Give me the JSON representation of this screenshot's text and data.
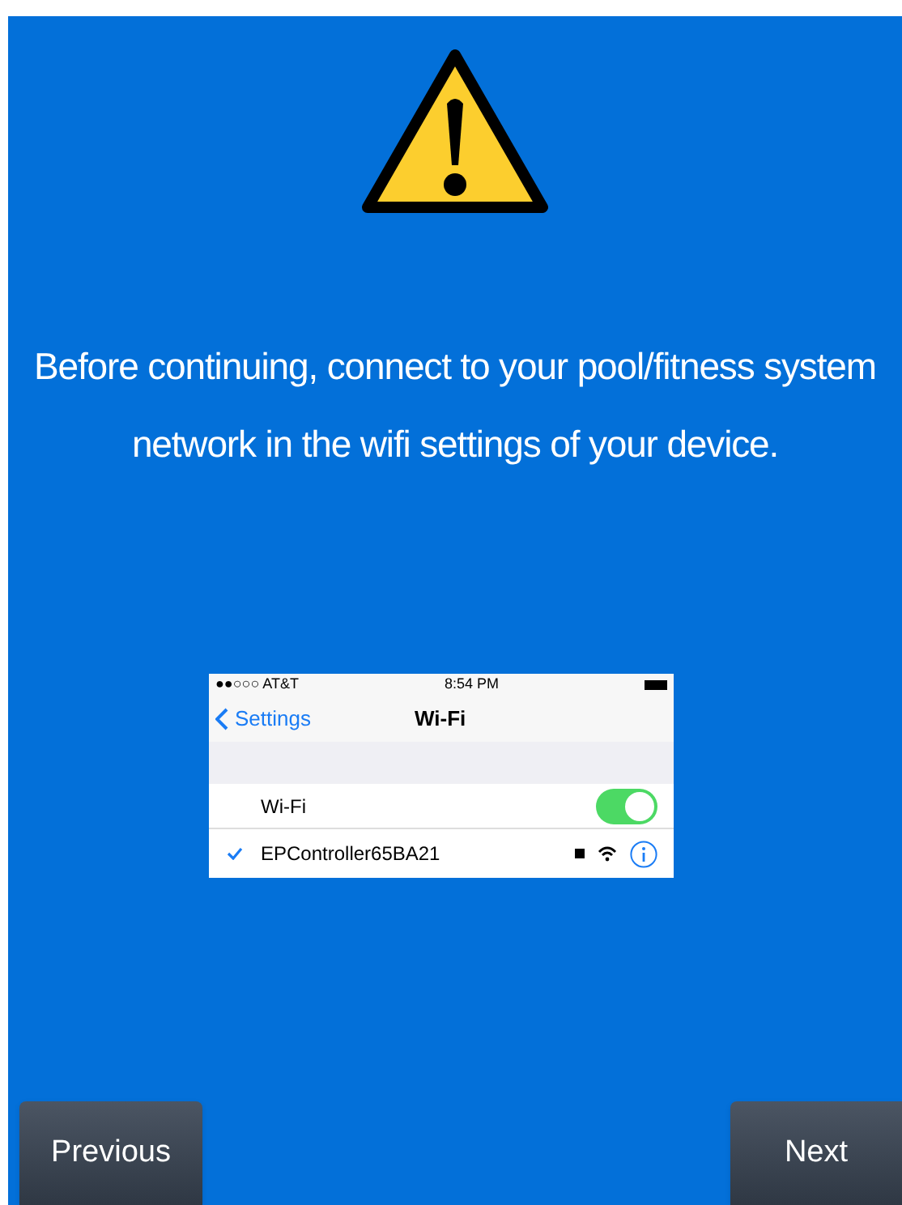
{
  "message": "Before continuing, connect to your pool/fitness system network in the wifi settings of your device.",
  "phone_screenshot": {
    "status_bar": {
      "carrier": "●●○○○ AT&T",
      "time": "8:54 PM"
    },
    "nav": {
      "back": "Settings",
      "title": "Wi-Fi"
    },
    "wifi_row": {
      "label": "Wi-Fi",
      "on": true
    },
    "networks": [
      {
        "name": "EPController65BA21",
        "selected": true
      }
    ]
  },
  "buttons": {
    "previous": "Previous",
    "next": "Next"
  }
}
